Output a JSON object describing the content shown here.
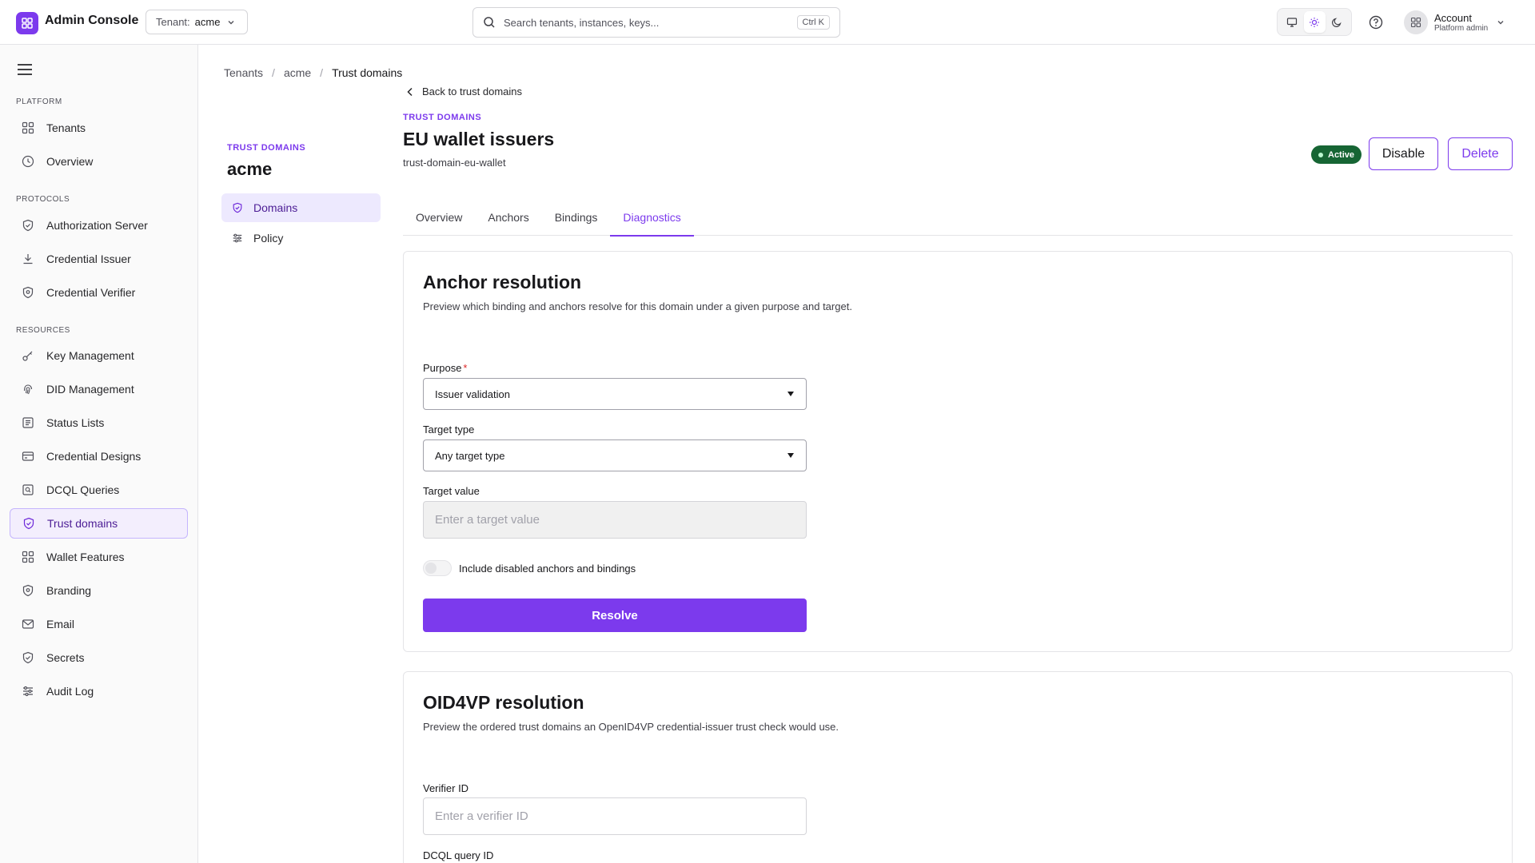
{
  "app": {
    "title": "Admin Console"
  },
  "tenant": {
    "label": "Tenant:",
    "value": "acme"
  },
  "search": {
    "placeholder": "Search tenants, instances, keys...",
    "shortcut": "Ctrl K"
  },
  "account": {
    "name": "Account",
    "role": "Platform admin"
  },
  "sidebar": {
    "sections": {
      "platform": "PLATFORM",
      "protocols": "PROTOCOLS",
      "resources": "RESOURCES"
    },
    "items": [
      {
        "label": "Tenants",
        "icon": "grid-icon"
      },
      {
        "label": "Overview",
        "icon": "clock-icon"
      },
      {
        "label": "Authorization Server",
        "icon": "shield-check-icon"
      },
      {
        "label": "Credential Issuer",
        "icon": "download-icon"
      },
      {
        "label": "Credential Verifier",
        "icon": "shield-icon"
      },
      {
        "label": "Key Management",
        "icon": "key-icon"
      },
      {
        "label": "DID Management",
        "icon": "fingerprint-icon"
      },
      {
        "label": "Status Lists",
        "icon": "list-icon"
      },
      {
        "label": "Credential Designs",
        "icon": "card-icon"
      },
      {
        "label": "DCQL Queries",
        "icon": "query-icon"
      },
      {
        "label": "Trust domains",
        "icon": "shield-check-icon",
        "active": true
      },
      {
        "label": "Wallet Features",
        "icon": "grid-icon"
      },
      {
        "label": "Branding",
        "icon": "shield-icon"
      },
      {
        "label": "Email",
        "icon": "mail-icon"
      },
      {
        "label": "Secrets",
        "icon": "shield-check-icon"
      },
      {
        "label": "Audit Log",
        "icon": "sliders-icon"
      }
    ]
  },
  "subnav": {
    "eyebrow": "TRUST DOMAINS",
    "title": "acme",
    "items": [
      {
        "label": "Domains",
        "icon": "shield-check-icon",
        "active": true
      },
      {
        "label": "Policy",
        "icon": "sliders-icon"
      }
    ]
  },
  "breadcrumb": [
    "Tenants",
    "acme",
    "Trust domains"
  ],
  "header": {
    "back": "Back to trust domains",
    "eyebrow": "TRUST DOMAINS",
    "title": "EU wallet issuers",
    "subtitle": "trust-domain-eu-wallet",
    "status": "Active",
    "status_color": "#166534",
    "disable": "Disable",
    "delete": "Delete"
  },
  "tabs": [
    "Overview",
    "Anchors",
    "Bindings",
    "Diagnostics"
  ],
  "active_tab": "Diagnostics",
  "anchor_resolution": {
    "title": "Anchor resolution",
    "description": "Preview which binding and anchors resolve for this domain under a given purpose and target.",
    "purpose_label": "Purpose",
    "purpose_required": "*",
    "purpose_value": "Issuer validation",
    "target_type_label": "Target type",
    "target_type_value": "Any target type",
    "target_value_label": "Target value",
    "target_value_placeholder": "Enter a target value",
    "toggle_label": "Include disabled anchors and bindings",
    "resolve": "Resolve"
  },
  "oid4vp_resolution": {
    "title": "OID4VP resolution",
    "description": "Preview the ordered trust domains an OpenID4VP credential-issuer trust check would use.",
    "verifier_label": "Verifier ID",
    "verifier_placeholder": "Enter a verifier ID",
    "dcql_label": "DCQL query ID"
  },
  "colors": {
    "accent": "#7c3aed",
    "active_badge": "#166534"
  }
}
